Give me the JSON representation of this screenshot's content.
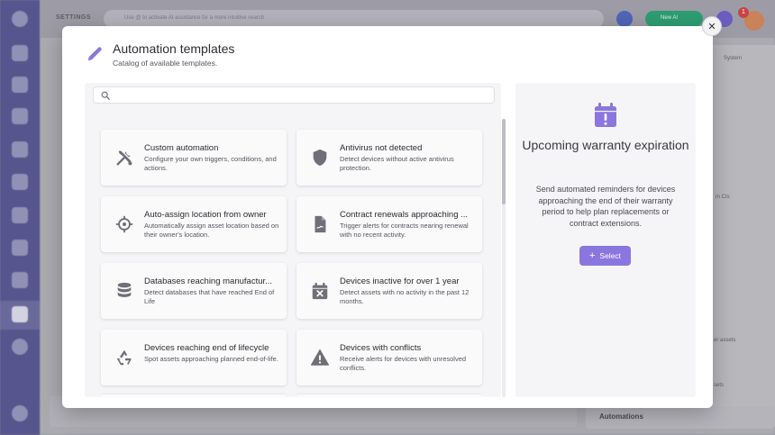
{
  "background": {
    "section_label": "SETTINGS",
    "search_placeholder": "Use @ to activate AI assistance for a more intuitive search",
    "primary_button": "New AI",
    "notification_count": "1",
    "right_panel_texts": [
      "System",
      "m CIs",
      "er assets",
      "sets"
    ],
    "bottom_label": "Automations"
  },
  "modal": {
    "title": "Automation templates",
    "subtitle": "Catalog of available templates.",
    "close_label": "✕",
    "search": {
      "value": "",
      "placeholder": ""
    },
    "templates": [
      {
        "title": "Custom automation",
        "description": "Configure your own triggers, conditions, and actions.",
        "icon": "wrench-screwdriver-icon"
      },
      {
        "title": "Antivirus not detected",
        "description": "Detect devices without active antivirus protection.",
        "icon": "shield-icon"
      },
      {
        "title": "Auto-assign location from owner",
        "description": "Automatically assign asset location based on their owner's location.",
        "icon": "crosshair-icon"
      },
      {
        "title": "Contract renewals approaching ...",
        "description": "Trigger alerts for contracts nearing renewal with no recent activity.",
        "icon": "contract-document-icon"
      },
      {
        "title": "Databases reaching manufactur...",
        "description": "Detect databases that have reached End of Life",
        "icon": "database-icon"
      },
      {
        "title": "Devices inactive for over 1 year",
        "description": "Detect assets with no activity in the past 12 months.",
        "icon": "calendar-x-icon"
      },
      {
        "title": "Devices reaching end of lifecycle",
        "description": "Spot assets approaching planned end-of-life.",
        "icon": "recycle-icon"
      },
      {
        "title": "Devices with conflicts",
        "description": "Receive alerts for devices with unresolved conflicts.",
        "icon": "warning-icon"
      }
    ],
    "detail": {
      "title": "Upcoming warranty expiration",
      "description": "Send automated reminders for devices approaching the end of their warranty period to help plan replacements or contract extensions.",
      "select_label": "Select",
      "icon": "calendar-alert-icon"
    }
  },
  "colors": {
    "accent": "#8a76de",
    "sidebar": "#56558e",
    "success": "#2d9d72"
  }
}
